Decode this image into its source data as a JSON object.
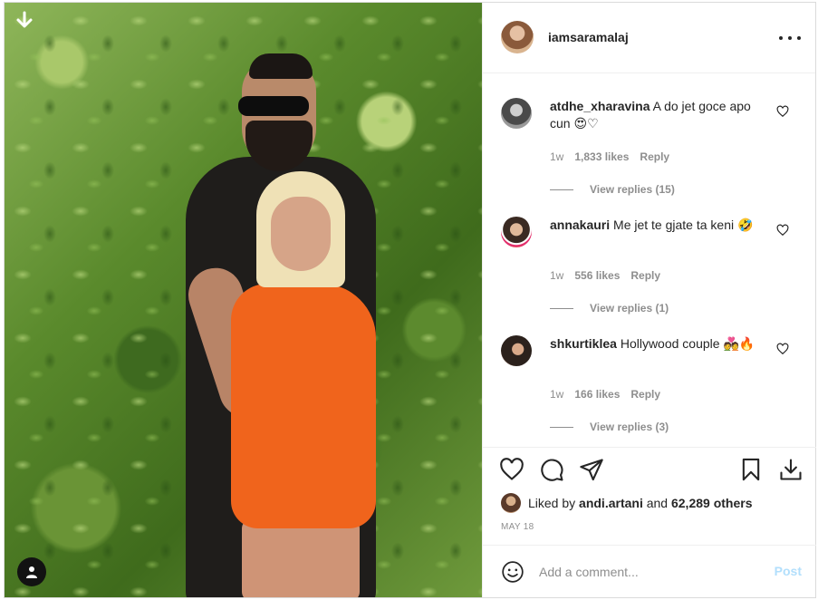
{
  "post": {
    "username": "iamsaramalaj",
    "header_avatar_icon": "profile-avatar-icon",
    "more_icon": "more-options-icon"
  },
  "photo": {
    "download_icon": "download-arrow-icon",
    "user_tag_icon": "user-tag-icon"
  },
  "comments": [
    {
      "username": "atdhe_xharavina",
      "text": "A do jet goce apo cun",
      "emoji": "😍♡",
      "age": "1w",
      "likes": "1,833 likes",
      "reply": "Reply",
      "view_replies": "View replies (15)"
    },
    {
      "username": "annakauri",
      "text": "Me jet te gjate ta keni",
      "emoji": "🤣",
      "age": "1w",
      "likes": "556 likes",
      "reply": "Reply",
      "view_replies": "View replies (1)"
    },
    {
      "username": "shkurtiklea",
      "text": "Hollywood couple",
      "emoji": "💑🔥",
      "age": "1w",
      "likes": "166 likes",
      "reply": "Reply",
      "view_replies": "View replies (3)"
    }
  ],
  "actions": {
    "like_icon": "heart-icon",
    "comment_icon": "comment-bubble-icon",
    "share_icon": "paper-plane-icon",
    "save_icon": "bookmark-icon",
    "download_icon": "download-icon"
  },
  "likes": {
    "prefix": "Liked by",
    "user": "andi.artani",
    "and": "and",
    "others": "62,289 others"
  },
  "date": "MAY 18",
  "add_comment": {
    "placeholder": "Add a comment...",
    "post_label": "Post"
  },
  "colors": {
    "text": "#262626",
    "muted": "#8e8e8e",
    "post_disabled": "#b2dffc",
    "border": "#dbdbdb"
  }
}
